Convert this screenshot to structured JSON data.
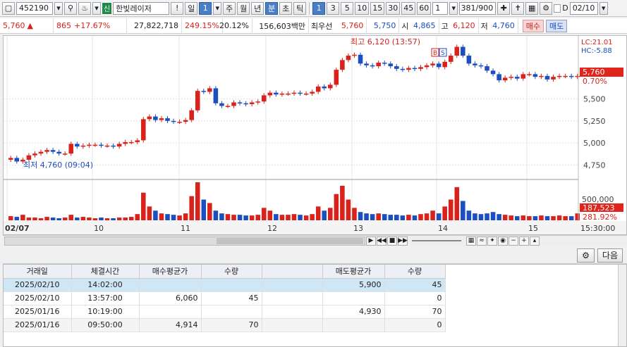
{
  "toolbar": {
    "code": "452190",
    "market_badge": "신",
    "stock_name": "한빛레이저",
    "periods": [
      "일",
      "주",
      "월",
      "년",
      "분",
      "초",
      "틱"
    ],
    "period_selected_value": "1",
    "intervals": [
      "1",
      "3",
      "5",
      "10",
      "15",
      "30",
      "45",
      "60"
    ],
    "custom_interval": "1",
    "count": "381",
    "count_max": "/900",
    "date": "02/10",
    "d_label": "D"
  },
  "quote": {
    "price": "5,760",
    "change": "865",
    "change_rate": "+17.67%",
    "volume": "27,822,718",
    "volume_ratio": "249.15%",
    "turnover": "20.12%",
    "amount": "156,603백만",
    "best_label": "최우선",
    "ask": "5,760",
    "bid": "5,750",
    "open_label": "시",
    "open": "4,865",
    "high_label": "고",
    "high": "6,120",
    "low_label": "저",
    "low": "4,760",
    "buy_label": "매수",
    "sell_label": "매도"
  },
  "chart_data": {
    "type": "candlestick",
    "price_axis": [
      "5,500",
      "5,250",
      "5,000",
      "4,750"
    ],
    "price_range": [
      4650,
      6150
    ],
    "x_labels": [
      "02/07",
      "10",
      "11",
      "12",
      "13",
      "14",
      "15",
      "15:30:00"
    ],
    "high_annotation": "최고 6,120 (13:57)",
    "low_annotation": "최저 4,760 (09:04)",
    "lc_label": "LC:21.01",
    "hc_label": "HC:-5.88",
    "current_price": "5,760",
    "current_rate": "0.70%",
    "volume_axis": [
      "500,000"
    ],
    "volume_current": "187,523",
    "volume_rate": "281.92%",
    "price_series": [
      4830,
      4790,
      4810,
      4860,
      4880,
      4900,
      4920,
      4900,
      4880,
      4880,
      4990,
      4960,
      4970,
      4980,
      4980,
      4970,
      4970,
      4960,
      4990,
      5010,
      5010,
      5030,
      5270,
      5300,
      5260,
      5280,
      5250,
      5240,
      5240,
      5260,
      5370,
      5590,
      5580,
      5620,
      5450,
      5420,
      5420,
      5460,
      5450,
      5440,
      5460,
      5470,
      5540,
      5570,
      5550,
      5560,
      5560,
      5570,
      5560,
      5560,
      5580,
      5640,
      5620,
      5660,
      5830,
      5940,
      5990,
      6000,
      5900,
      5880,
      5870,
      5910,
      5900,
      5870,
      5840,
      5830,
      5850,
      5840,
      5860,
      5880,
      5900,
      5860,
      5920,
      5990,
      6090,
      5990,
      5900,
      5880,
      5870,
      5820,
      5780,
      5710,
      5740,
      5750,
      5730,
      5780,
      5780,
      5750,
      5760,
      5720,
      5750,
      5760,
      5760,
      5750,
      5760
    ],
    "volume_series": [
      6,
      5,
      8,
      4,
      4,
      3,
      5,
      4,
      3,
      4,
      8,
      4,
      5,
      4,
      3,
      4,
      3,
      3,
      4,
      4,
      5,
      9,
      40,
      20,
      14,
      10,
      9,
      8,
      7,
      10,
      35,
      55,
      30,
      25,
      14,
      10,
      9,
      8,
      8,
      7,
      7,
      8,
      18,
      14,
      9,
      8,
      8,
      9,
      8,
      7,
      9,
      20,
      14,
      18,
      38,
      50,
      30,
      18,
      12,
      10,
      9,
      10,
      9,
      8,
      8,
      7,
      8,
      7,
      9,
      10,
      14,
      10,
      20,
      30,
      48,
      28,
      14,
      10,
      9,
      10,
      12,
      9,
      8,
      7,
      6,
      7,
      6,
      6,
      7,
      6,
      6,
      7,
      6,
      6,
      10
    ],
    "grid": true,
    "colors": {
      "up": "#d8221b",
      "down": "#1b4fc0"
    }
  },
  "panel": {
    "next_label": "다음"
  },
  "trade_table": {
    "headers": [
      "거래일",
      "체결시간",
      "매수평균가",
      "수량",
      "",
      "매도평균가",
      "수량"
    ],
    "rows": [
      [
        "2025/02/10",
        "14:02:00",
        "",
        "",
        "",
        "5,900",
        "45"
      ],
      [
        "2025/02/10",
        "13:57:00",
        "6,060",
        "45",
        "",
        "",
        "0"
      ],
      [
        "2025/01/16",
        "10:19:00",
        "",
        "",
        "",
        "4,930",
        "70"
      ],
      [
        "2025/01/16",
        "09:50:00",
        "4,914",
        "70",
        "",
        "",
        "0"
      ]
    ]
  }
}
